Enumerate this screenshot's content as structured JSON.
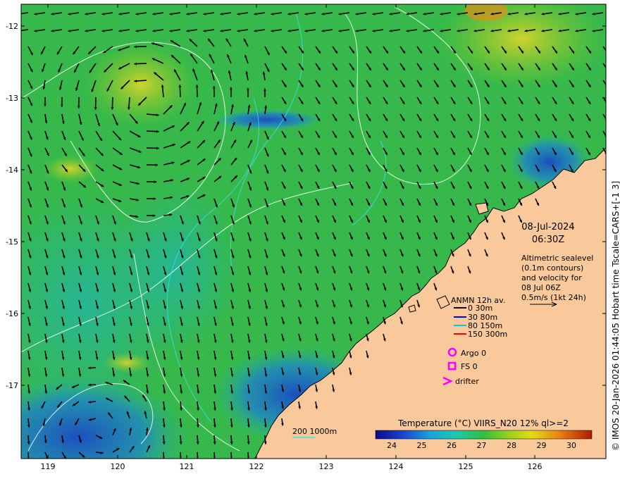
{
  "map": {
    "date": "08-Jul-2024",
    "time": "06:30Z",
    "description_lines": [
      "Altimetric sealevel",
      "(0.1m contours)",
      "and velocity for",
      "08 Jul 06Z",
      "0.5m/s (1kt 24h)"
    ],
    "x_ticks": [
      "119",
      "120",
      "121",
      "122",
      "123",
      "124",
      "125",
      "126"
    ],
    "y_ticks": [
      "-12",
      "-13",
      "-14",
      "-15",
      "-16",
      "-17"
    ],
    "legend": {
      "title": "ANMN 12h av.",
      "items": [
        {
          "label": "0 30m",
          "color": "#000000"
        },
        {
          "label": "30 80m",
          "color": "#0000ff"
        },
        {
          "label": "80 150m",
          "color": "#00c8ff"
        },
        {
          "label": "150 300m",
          "color": "#ff0000"
        }
      ],
      "markers": [
        {
          "label": "Argo 0",
          "color": "#ff00ff"
        },
        {
          "label": "FS 0",
          "color": "#ff00ff"
        },
        {
          "label": "drifter",
          "color": "#ff00ff"
        }
      ]
    },
    "depth_label": "200  1000m",
    "colorbar": {
      "title": "Temperature (°C) VIIRS_N20 12% ql>=2",
      "labels": [
        "24",
        "25",
        "26",
        "27",
        "28",
        "29",
        "30"
      ]
    },
    "credit": "© IMOS 20-Jan-2026 01:44:05 Hobart time Tscale=CARS+[-1 3]",
    "colors": {
      "land": "#f9c99b",
      "sea_base": "#33b84a",
      "cold": "#1a3fae",
      "warm": "#d9d31e"
    }
  }
}
